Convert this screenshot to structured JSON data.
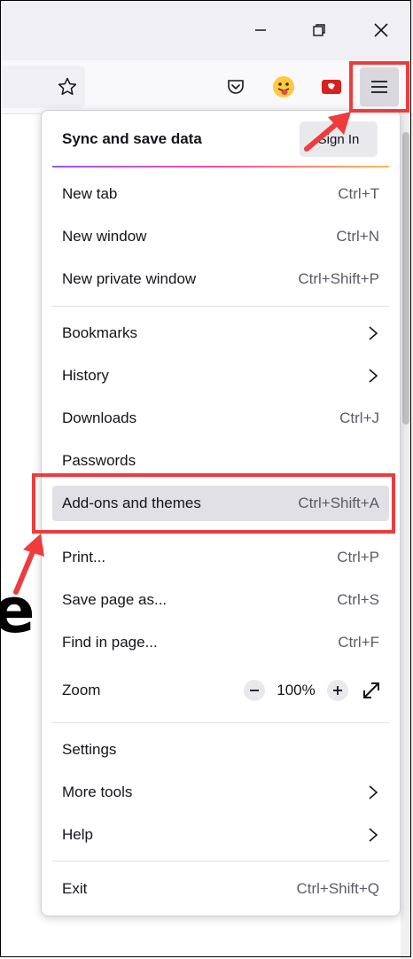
{
  "menu": {
    "sync_title": "Sync and save data",
    "signin_label": "Sign In",
    "items": [
      {
        "label": "New tab",
        "shortcut": "Ctrl+T"
      },
      {
        "label": "New window",
        "shortcut": "Ctrl+N"
      },
      {
        "label": "New private window",
        "shortcut": "Ctrl+Shift+P"
      },
      {
        "label": "Bookmarks"
      },
      {
        "label": "History"
      },
      {
        "label": "Downloads",
        "shortcut": "Ctrl+J"
      },
      {
        "label": "Passwords"
      },
      {
        "label": "Add-ons and themes",
        "shortcut": "Ctrl+Shift+A"
      },
      {
        "label": "Print...",
        "shortcut": "Ctrl+P"
      },
      {
        "label": "Save page as...",
        "shortcut": "Ctrl+S"
      },
      {
        "label": "Find in page...",
        "shortcut": "Ctrl+F"
      },
      {
        "label": "Settings"
      },
      {
        "label": "More tools"
      },
      {
        "label": "Help"
      },
      {
        "label": "Exit",
        "shortcut": "Ctrl+Shift+Q"
      }
    ],
    "zoom": {
      "label": "Zoom",
      "value": "100%"
    }
  },
  "page": {
    "big_letter": "e"
  },
  "colors": {
    "highlight": "#ee3b3b",
    "accent_gradient": [
      "#9059ff",
      "#ff4aa2",
      "#ffbd4f"
    ]
  },
  "icons": [
    "minimize-icon",
    "restore-icon",
    "close-icon",
    "bookmark-star-icon",
    "pocket-icon",
    "tongue-emoji-extension-icon",
    "red-extension-icon",
    "hamburger-menu-icon"
  ]
}
